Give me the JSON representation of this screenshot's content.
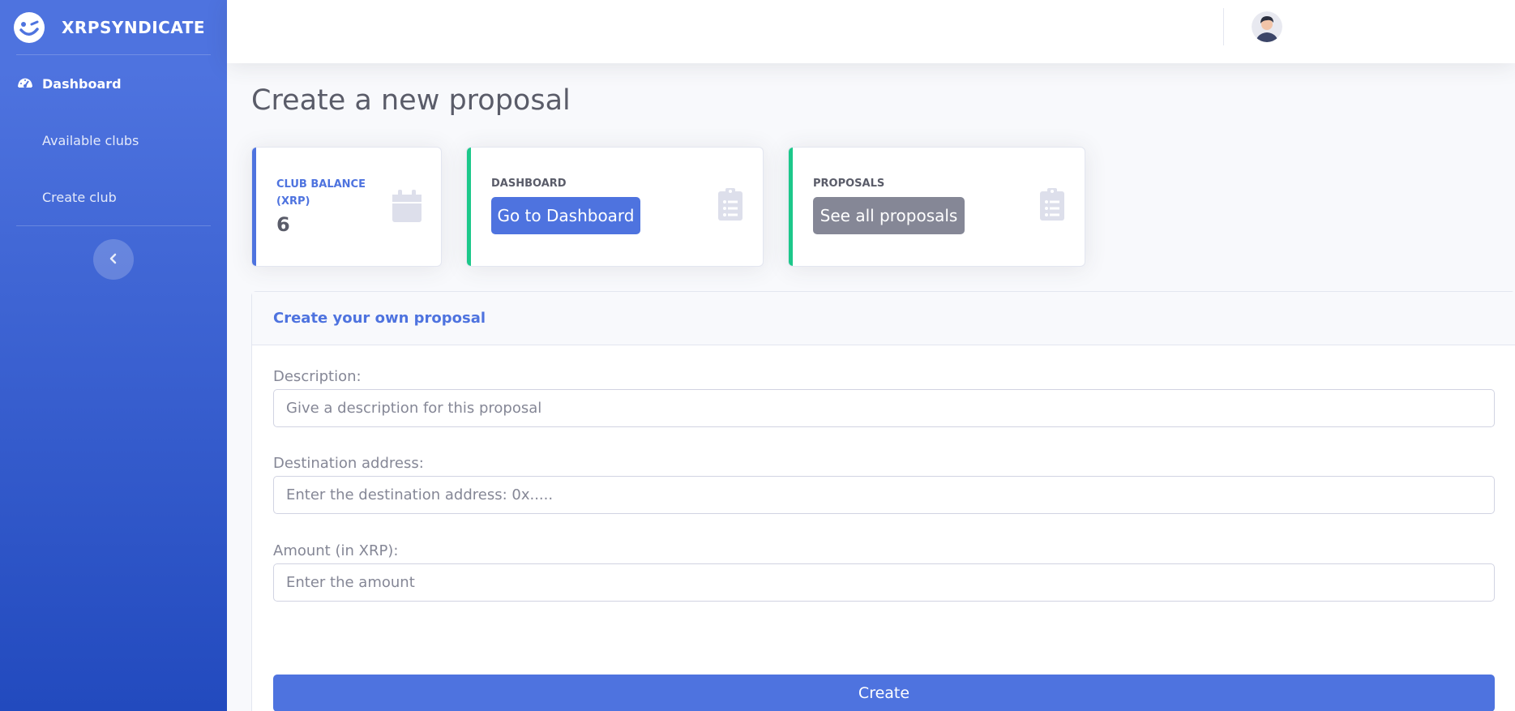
{
  "brand": {
    "name": "XRPSYNDICATE",
    "icon": "winking-smiley-icon"
  },
  "sidebar": {
    "items": [
      {
        "label": "Dashboard",
        "icon": "tachometer-icon",
        "active": true
      },
      {
        "label": "Available clubs"
      },
      {
        "label": "Create club"
      }
    ],
    "toggle_icon": "chevron-left-icon"
  },
  "topbar": {
    "avatar_icon": "user-avatar"
  },
  "page": {
    "title": "Create a new proposal"
  },
  "cards": {
    "balance": {
      "label": "Club Balance (XRP)",
      "value": "6",
      "icon": "calendar-icon",
      "accent": "#4e73df"
    },
    "dashboard": {
      "label": "Dashboard",
      "button": "Go to Dashboard",
      "icon": "clipboard-list-icon",
      "accent": "#1cc88a"
    },
    "proposals": {
      "label": "Proposals",
      "button": "See all proposals",
      "icon": "clipboard-list-icon",
      "accent": "#1cc88a"
    }
  },
  "form": {
    "header": "Create your own proposal",
    "description": {
      "label": "Description:",
      "placeholder": "Give a description for this proposal",
      "value": ""
    },
    "destination": {
      "label": "Destination address:",
      "placeholder": "Enter the destination address: 0x.....",
      "value": ""
    },
    "amount": {
      "label": "Amount (in XRP):",
      "placeholder": "Enter the amount",
      "value": ""
    },
    "submit": "Create"
  },
  "colors": {
    "primary": "#4e73df",
    "success": "#1cc88a",
    "secondary": "#858796",
    "text_dark": "#5a5c69"
  }
}
